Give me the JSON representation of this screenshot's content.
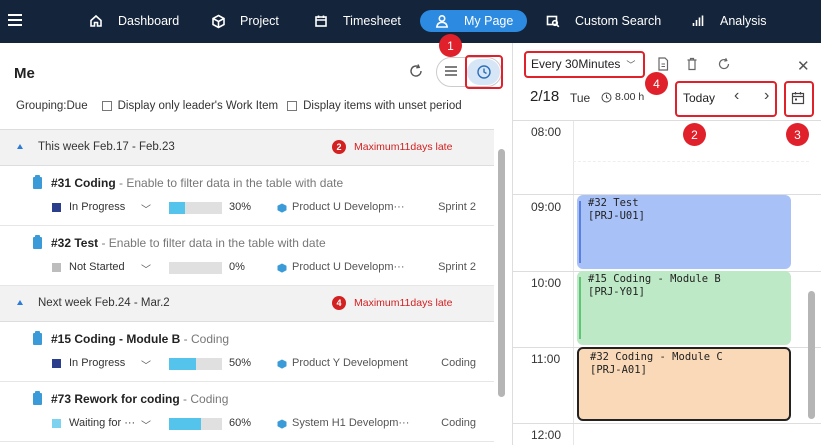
{
  "nav": {
    "items": [
      {
        "label": "Dashboard",
        "icon": "home-icon"
      },
      {
        "label": "Project",
        "icon": "project-icon"
      },
      {
        "label": "Timesheet",
        "icon": "calendar-icon"
      },
      {
        "label": "My Page",
        "icon": "user-icon",
        "active": true
      },
      {
        "label": "Custom Search",
        "icon": "search-icon"
      },
      {
        "label": "Analysis",
        "icon": "chart-icon"
      }
    ]
  },
  "left": {
    "title": "Me",
    "grouping": "Grouping:Due",
    "filter_leader": "Display only leader's Work Item",
    "filter_unset": "Display items with unset period",
    "callout_1": "1",
    "groups": [
      {
        "label": "This week Feb.17 - Feb.23",
        "badge": "2",
        "late": "Maximum11days late",
        "items": [
          {
            "id": "#31 Coding",
            "desc": " - Enable to filter data in the table with date",
            "status": "In Progress",
            "status_color": "#2b3e8c",
            "progress": 30,
            "progress_label": "30%",
            "product": "Product U Developm···",
            "sprint": "Sprint 2"
          },
          {
            "id": "#32 Test",
            "desc": " - Enable to filter data in the table with date",
            "status": "Not Started",
            "status_color": "#bdbdbd",
            "progress": 0,
            "progress_label": "0%",
            "product": "Product U Developm···",
            "sprint": "Sprint 2"
          }
        ]
      },
      {
        "label": "Next week Feb.24 - Mar.2",
        "badge": "4",
        "late": "Maximum11days late",
        "items": [
          {
            "id": "#15 Coding - Module B",
            "desc": " - Coding",
            "status": "In Progress",
            "status_color": "#2b3e8c",
            "progress": 50,
            "progress_label": "50%",
            "product": "Product Y Development",
            "sprint": "Coding"
          },
          {
            "id": "#73 Rework for coding",
            "desc": " - Coding",
            "status": "Waiting for ···",
            "status_color": "#7dd3ef",
            "progress": 60,
            "progress_label": "60%",
            "product": "System H1 Developm···",
            "sprint": "Coding"
          }
        ]
      }
    ]
  },
  "right": {
    "interval": "Every 30Minutes",
    "date": "2/18",
    "day": "Tue",
    "hours": "8.00 h",
    "today": "Today",
    "callout_2": "2",
    "callout_3": "3",
    "callout_4": "4",
    "time_labels": [
      "08:00",
      "09:00",
      "10:00",
      "11:00",
      "12:00"
    ],
    "events": [
      {
        "line1": "#32 Test",
        "line2": "[PRJ-U01]",
        "bg": "#a8c1f7",
        "stripe": "#5a7fe0"
      },
      {
        "line1": "#15 Coding - Module B",
        "line2": "[PRJ-Y01]",
        "bg": "#bde9c6",
        "stripe": "#5fc474"
      },
      {
        "line1": "#32 Coding - Module C",
        "line2": "[PRJ-A01]",
        "bg": "#f9d9b7",
        "stripe": "#f9d9b7"
      }
    ]
  }
}
